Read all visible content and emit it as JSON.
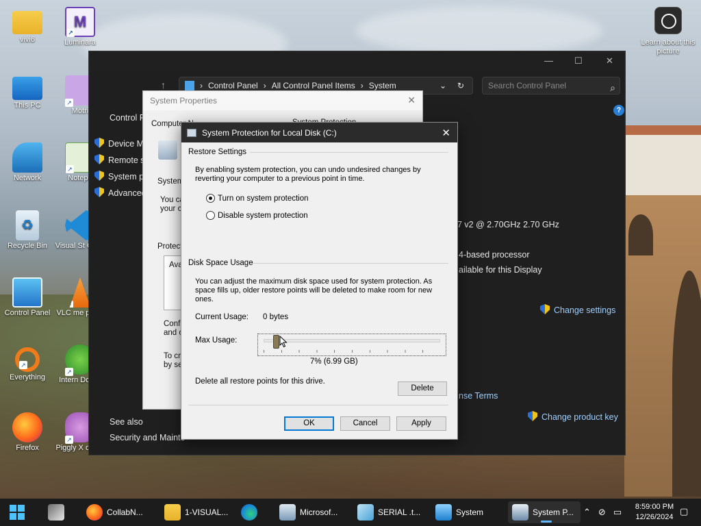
{
  "desktop": {
    "icons": [
      {
        "label": "vivi6"
      },
      {
        "label": "Luminara"
      },
      {
        "label": "This PC"
      },
      {
        "label": "Motri"
      },
      {
        "label": "Network"
      },
      {
        "label": "Notepa"
      },
      {
        "label": "Recycle Bin"
      },
      {
        "label": "Visual St Code"
      },
      {
        "label": "Control Panel"
      },
      {
        "label": "VLC me playe"
      },
      {
        "label": "Everything"
      },
      {
        "label": "Intern Downl"
      },
      {
        "label": "Firefox"
      },
      {
        "label": "Piggly X demo"
      }
    ],
    "learn_label": "Learn about this picture"
  },
  "control_panel": {
    "breadcrumb": [
      "Control Panel",
      "All Control Panel Items",
      "System"
    ],
    "search_placeholder": "Search Control Panel",
    "sidebar_title": "Control P",
    "sidebar_links": [
      "Device M",
      "Remote s",
      "System p",
      "Advanced"
    ],
    "processor_text": "7 v2 @ 2.70GHz   2.70 GHz",
    "system_type_text": "4-based processor",
    "display_text": "ailable for this Display",
    "change_settings": "Change settings",
    "license_terms": "nse Terms",
    "change_product_key": "Change product key",
    "see_also": "See also",
    "security_maint": "Security and Mainte"
  },
  "system_properties": {
    "title": "System Properties",
    "tabs_fragment": "Computer N",
    "tab_active_fragment": "System Protection",
    "frag_system": "System",
    "frag_youca": "You ca",
    "frag_yourco": "your co",
    "frag_protect": "Protect",
    "frag_ava": "Ava",
    "frag_confi": "Confi",
    "frag_and": "and c",
    "frag_tocr": "To cr",
    "frag_byse": "by se"
  },
  "dialog": {
    "title": "System Protection for Local Disk (C:)",
    "restore_settings_label": "Restore Settings",
    "restore_desc": "By enabling system protection, you can undo undesired changes by reverting your computer to a previous point in time.",
    "radio_on": "Turn on system protection",
    "radio_off": "Disable system protection",
    "selected": "on",
    "disk_usage_label": "Disk Space Usage",
    "disk_desc": "You can adjust the maximum disk space used for system protection. As space fills up, older restore points will be deleted to make room for new ones.",
    "current_usage_label": "Current Usage:",
    "current_usage_value": "0 bytes",
    "max_usage_label": "Max Usage:",
    "max_usage_percent": 7,
    "max_usage_value": "7% (6.99 GB)",
    "delete_desc": "Delete all restore points for this drive.",
    "delete_button": "Delete",
    "ok_button": "OK",
    "cancel_button": "Cancel",
    "apply_button": "Apply"
  },
  "taskbar": {
    "items": [
      {
        "label": "CollabN..."
      },
      {
        "label": "1-VISUAL..."
      },
      {
        "label": "Microsof..."
      },
      {
        "label": "SERIAL .t..."
      },
      {
        "label": "System"
      },
      {
        "label": "System P..."
      }
    ],
    "time": "8:59:00 PM",
    "date": "12/26/2024"
  }
}
